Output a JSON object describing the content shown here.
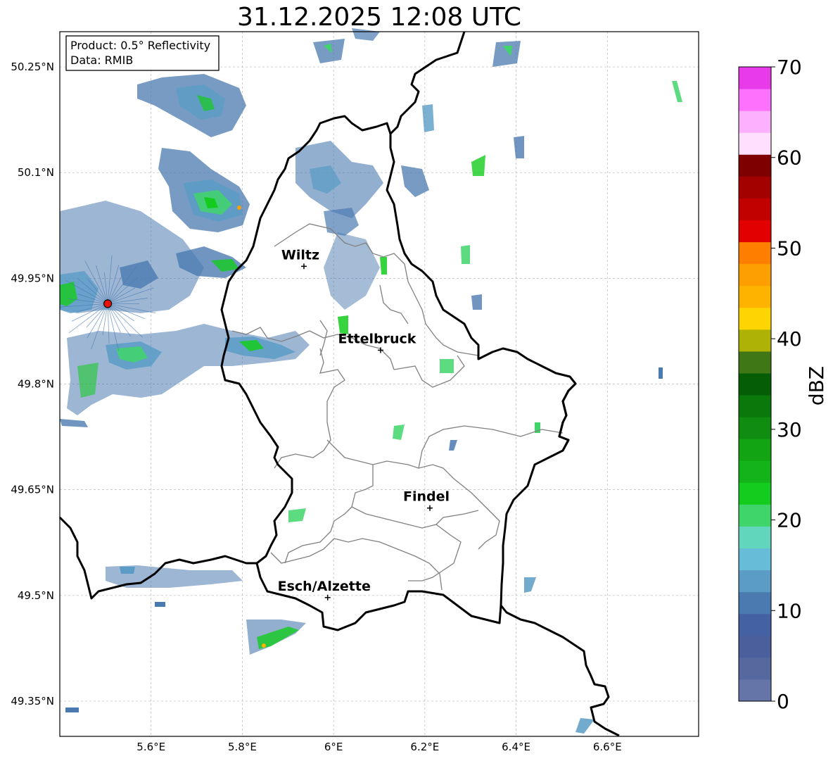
{
  "title": "31.12.2025 12:08 UTC",
  "info_box": {
    "product": "Product: 0.5° Reflectivity",
    "data": "Data: RMIB"
  },
  "axes": {
    "x_ticks": [
      "5.6°E",
      "5.8°E",
      "6°E",
      "6.2°E",
      "6.4°E",
      "6.6°E"
    ],
    "y_ticks": [
      "50.25°N",
      "50.1°N",
      "49.95°N",
      "49.8°N",
      "49.65°N",
      "49.5°N",
      "49.35°N"
    ],
    "lon_range": [
      5.4,
      6.8
    ],
    "lat_range": [
      49.3,
      50.3
    ],
    "grid": true
  },
  "cities": [
    {
      "name": "Wiltz",
      "lon": 5.935,
      "lat": 49.967
    },
    {
      "name": "Ettelbruck",
      "lon": 6.103,
      "lat": 49.848
    },
    {
      "name": "Findel",
      "lon": 6.211,
      "lat": 49.624
    },
    {
      "name": "Esch/Alzette",
      "lon": 5.987,
      "lat": 49.497
    }
  ],
  "radar_site": {
    "lon": 5.505,
    "lat": 49.914,
    "color": "#e8100c"
  },
  "colorbar": {
    "label": "dBZ",
    "range": [
      0,
      70
    ],
    "ticks": [
      "0",
      "10",
      "20",
      "30",
      "40",
      "50",
      "60",
      "70"
    ],
    "colors": [
      "#6675a8",
      "#56699e",
      "#4a5f9c",
      "#4461a3",
      "#4b7ab0",
      "#5b9cc6",
      "#67bcd8",
      "#61d6bd",
      "#3fd56a",
      "#14cc1e",
      "#13b41a",
      "#13a413",
      "#108c10",
      "#0a780a",
      "#055d05",
      "#407716",
      "#adb205",
      "#fed500",
      "#feb300",
      "#fe9f00",
      "#fe7e00",
      "#e20000",
      "#c10000",
      "#a30000",
      "#7e0000",
      "#fee0fe",
      "#fdb0fd",
      "#fc72fc",
      "#e93ae9"
    ]
  }
}
